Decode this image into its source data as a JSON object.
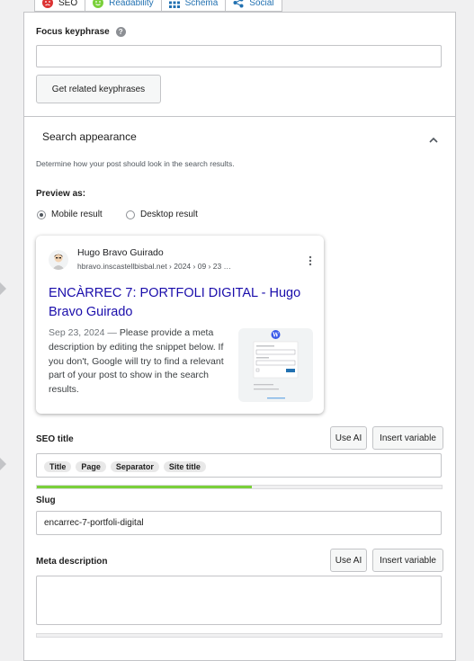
{
  "tabs": [
    {
      "label": "SEO",
      "icon": "seo-status-icon",
      "color": "#dc3232"
    },
    {
      "label": "Readability",
      "icon": "readability-status-icon",
      "color": "#7ad03a"
    },
    {
      "label": "Schema",
      "icon": "schema-grid-icon"
    },
    {
      "label": "Social",
      "icon": "share-icon"
    }
  ],
  "focus": {
    "label": "Focus keyphrase",
    "help": "?",
    "value": "",
    "related_button": "Get related keyphrases"
  },
  "search_appearance": {
    "title": "Search appearance",
    "description": "Determine how your post should look in the search results.",
    "preview_label": "Preview as:",
    "options": [
      "Mobile result",
      "Desktop result"
    ],
    "selected": "Mobile result"
  },
  "serp": {
    "site_name": "Hugo Bravo Guirado",
    "url": "hbravo.inscastellbisbal.net › 2024 › 09 › 23 …",
    "title": "ENCÀRREC 7: PORTFOLI DIGITAL - Hugo Bravo Guirado",
    "date": "Sep 23, 2024",
    "dash": "—",
    "description": "Please provide a meta description by editing the snippet below. If you don't, Google will try to find a relevant part of your post to show in the search results.",
    "title_color": "#1a0dab"
  },
  "seo_title": {
    "label": "SEO title",
    "use_ai": "Use AI",
    "insert_variable": "Insert variable",
    "chips": [
      "Title",
      "Page",
      "Separator",
      "Site title"
    ],
    "progress": 0.53,
    "progress_color": "#7ad03a"
  },
  "slug": {
    "label": "Slug",
    "value": "encarrec-7-portfoli-digital"
  },
  "meta_description": {
    "label": "Meta description",
    "use_ai": "Use AI",
    "insert_variable": "Insert variable",
    "value": ""
  }
}
